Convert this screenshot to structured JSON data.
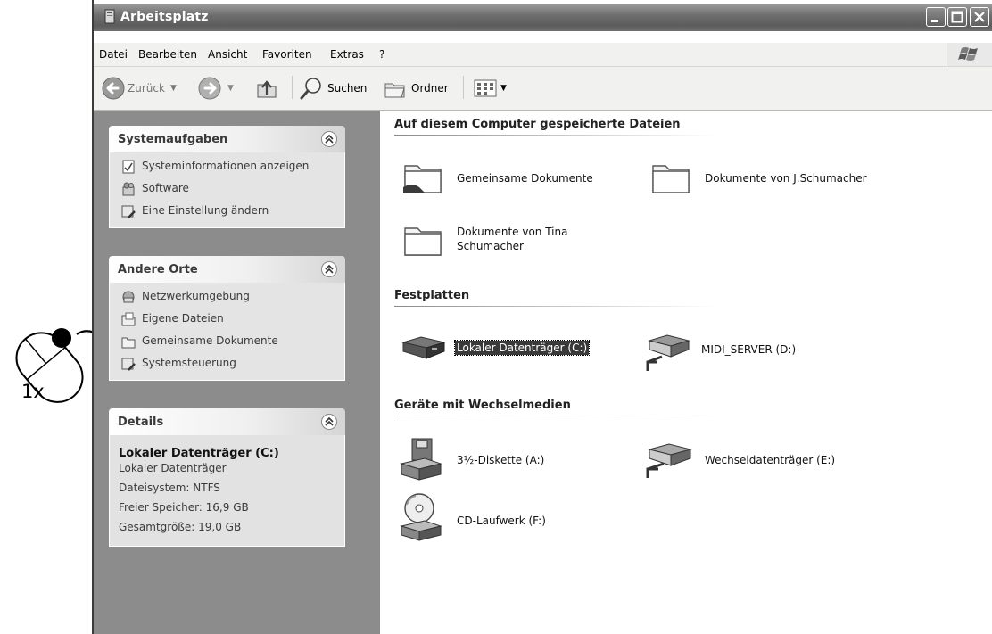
{
  "window": {
    "title": "Arbeitsplatz"
  },
  "menu": [
    "Datei",
    "Bearbeiten",
    "Ansicht",
    "Favoriten",
    "Extras",
    "?"
  ],
  "toolbar": {
    "back_label": "Zurück",
    "search_label": "Suchen",
    "folders_label": "Ordner"
  },
  "system_tasks": {
    "title": "Systemaufgaben",
    "items": [
      "Systeminformationen anzeigen",
      "Software",
      "Eine Einstellung ändern"
    ]
  },
  "other_places": {
    "title": "Andere Orte",
    "items": [
      "Netzwerkumgebung",
      "Eigene Dateien",
      "Gemeinsame Dokumente",
      "Systemsteuerung"
    ]
  },
  "details": {
    "title": "Details",
    "name": "Lokaler Datenträger (C:)",
    "type": "Lokaler Datenträger",
    "filesystem": "Dateisystem: NTFS",
    "free": "Freier Speicher: 16,9 GB",
    "total": "Gesamtgröße: 19,0 GB"
  },
  "groups": {
    "files": {
      "title": "Auf diesem Computer gespeicherte Dateien",
      "items": [
        "Gemeinsame Dokumente",
        "Dokumente von J.Schumacher",
        "Dokumente von Tina",
        "Schumacher"
      ]
    },
    "drives": {
      "title": "Festplatten",
      "items": [
        "Lokaler Datenträger (C:)",
        "MIDI_SERVER (D:)"
      ]
    },
    "removable": {
      "title": "Geräte mit Wechselmedien",
      "items": [
        "3½-Diskette (A:)",
        "Wechseldatenträger (E:)",
        "CD-Laufwerk (F:)"
      ]
    }
  },
  "annotation": {
    "click_label": "1x"
  }
}
